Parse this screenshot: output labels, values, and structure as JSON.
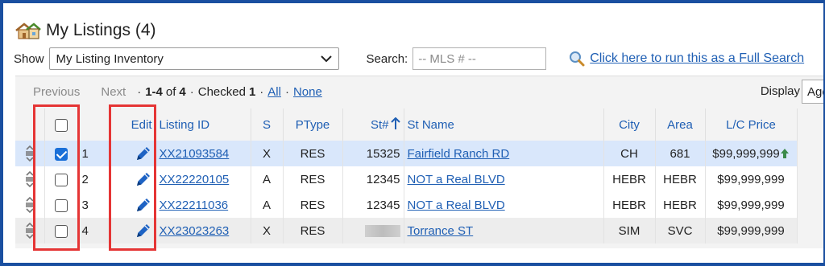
{
  "header": {
    "title": "My Listings (4)",
    "icon": "house-icon"
  },
  "filters": {
    "show_label": "Show",
    "show_value": "My Listing Inventory",
    "search_label": "Search:",
    "search_placeholder": "-- MLS # --",
    "full_search_link": "Click here to run this as a Full Search"
  },
  "pager": {
    "previous": "Previous",
    "next": "Next",
    "dot1": "·",
    "range": "1-4",
    "of": "of",
    "total": "4",
    "dot2": "·",
    "checked_label": "Checked",
    "checked_count": "1",
    "dot3": "·",
    "all": "All",
    "dot4": "·",
    "none": "None",
    "display_label": "Display",
    "display_value": "Agent"
  },
  "table": {
    "headers": {
      "edit": "Edit",
      "listing_id": "Listing ID",
      "status": "S",
      "ptype": "PType",
      "st_num": "St#",
      "st_name": "St Name",
      "city": "City",
      "area": "Area",
      "price": "L/C Price"
    },
    "rows": [
      {
        "num": "1",
        "checked": true,
        "listing_id": "XX21093584",
        "status": "X",
        "ptype": "RES",
        "st_num": "15325",
        "st_name": "Fairfield Ranch RD",
        "city": "CH",
        "area": "681",
        "price": "$99,999,999"
      },
      {
        "num": "2",
        "checked": false,
        "listing_id": "XX22220105",
        "status": "A",
        "ptype": "RES",
        "st_num": "12345",
        "st_name": "NOT a Real BLVD",
        "city": "HEBR",
        "area": "HEBR",
        "price": "$99,999,999"
      },
      {
        "num": "3",
        "checked": false,
        "listing_id": "XX22211036",
        "status": "A",
        "ptype": "RES",
        "st_num": "12345",
        "st_name": "NOT a Real BLVD",
        "city": "HEBR",
        "area": "HEBR",
        "price": "$99,999,999"
      },
      {
        "num": "4",
        "checked": false,
        "listing_id": "XX23023263",
        "status": "X",
        "ptype": "RES",
        "st_num": "",
        "st_name": "Torrance ST",
        "city": "SIM",
        "area": "SVC",
        "price": "$99,999,999"
      }
    ]
  },
  "colors": {
    "frame": "#1a4fa0",
    "link": "#1f5fb4",
    "highlight": "#e53535",
    "selected_row": "#d9e7fb",
    "checkbox": "#1a6fd8"
  }
}
